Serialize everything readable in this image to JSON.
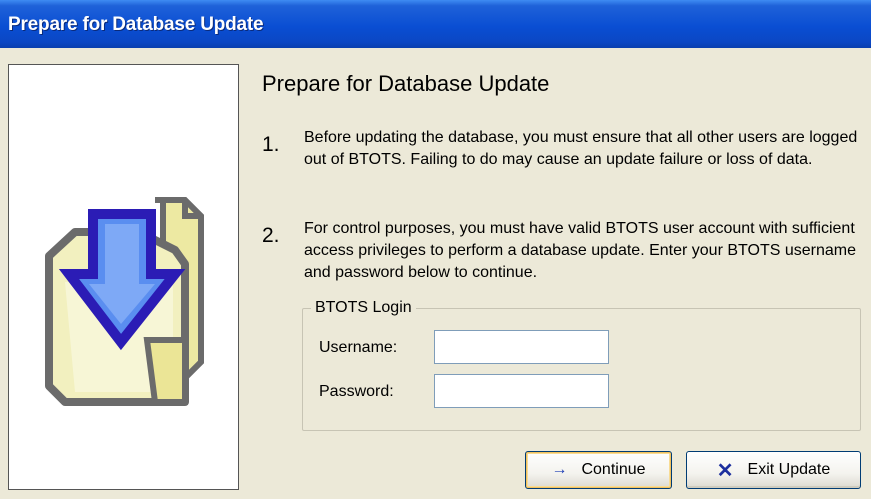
{
  "window": {
    "title": "Prepare for Database Update"
  },
  "graphic": {
    "icon": "database-download-folder-icon"
  },
  "content": {
    "heading": "Prepare for Database Update",
    "steps": [
      {
        "number": "1.",
        "text": "Before updating the database, you must ensure that all other users are logged out of BTOTS. Failing to do may cause an update failure or loss of data."
      },
      {
        "number": "2.",
        "text": "For control purposes, you must have valid BTOTS user account with sufficient access privileges to perform a database update. Enter your BTOTS username and password below to continue."
      }
    ]
  },
  "login": {
    "legend": "BTOTS Login",
    "username_label": "Username:",
    "username_value": "",
    "password_label": "Password:",
    "password_value": ""
  },
  "buttons": {
    "continue_label": "Continue",
    "continue_icon": "arrow-right-icon",
    "exit_label": "Exit Update",
    "exit_icon": "x-icon"
  },
  "colors": {
    "titlebar": "#0a4ed3",
    "background": "#ece9d8",
    "arrow_fill": "#5a8ef0",
    "arrow_outline": "#2b1cb5",
    "folder_fill": "#f3f1c0"
  }
}
